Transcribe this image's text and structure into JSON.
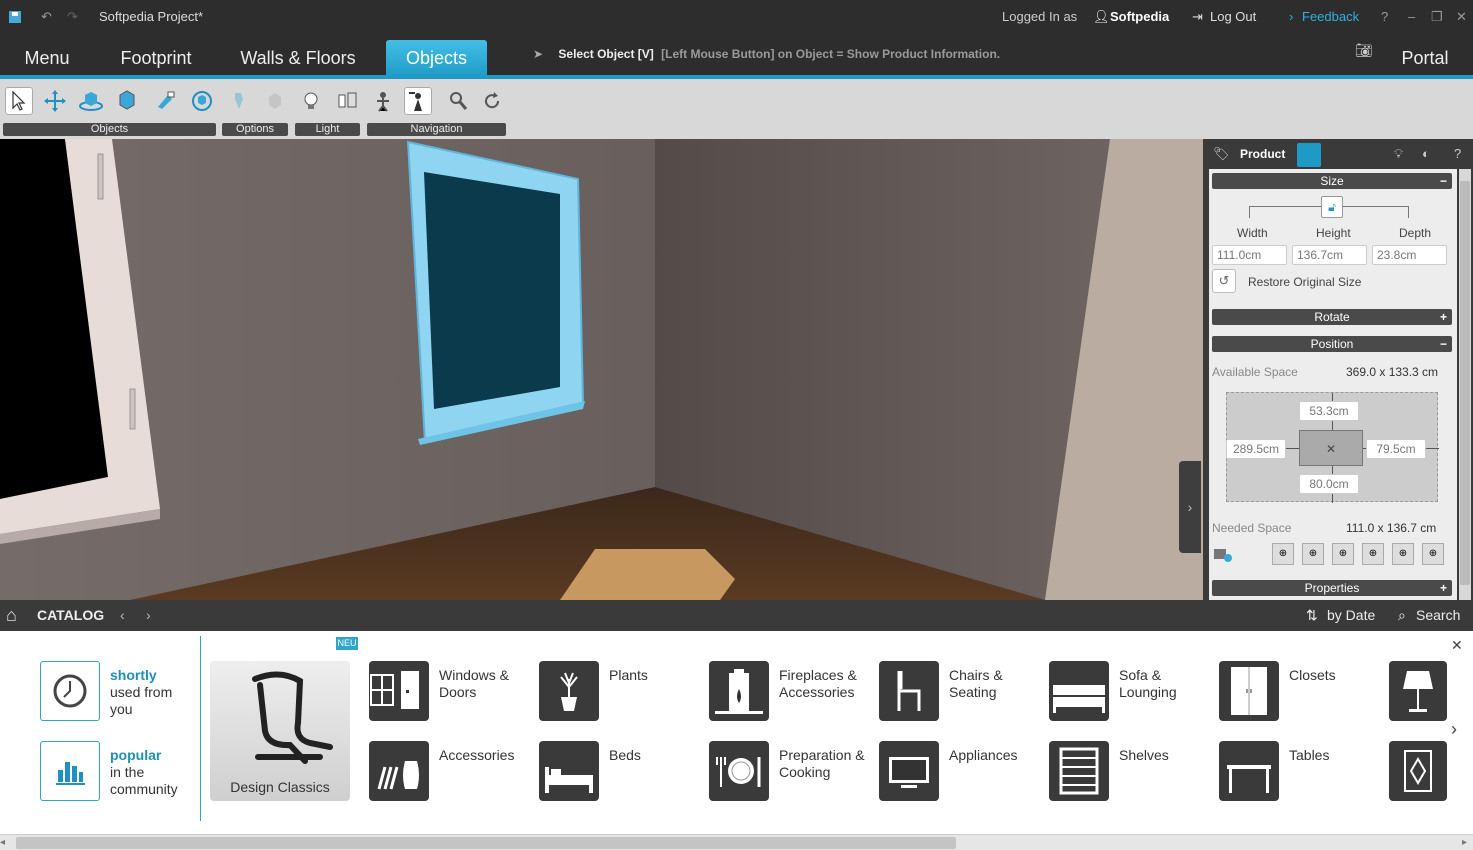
{
  "titlebar": {
    "project_title": "Softpedia Project*",
    "logged_in_as": "Logged In as",
    "username": "Softpedia",
    "logout": "Log Out",
    "feedback": "Feedback",
    "help": "?"
  },
  "nav": {
    "tabs": [
      {
        "label": "Menu"
      },
      {
        "label": "Footprint"
      },
      {
        "label": "Walls & Floors"
      },
      {
        "label": "Objects"
      }
    ],
    "active_tab": "Objects",
    "hint_bold": "Select Object [V]",
    "hint_text": "[Left Mouse Button] on Object = Show Product Information.",
    "portal": "Portal"
  },
  "toolbar": {
    "groups": [
      {
        "label": "Objects"
      },
      {
        "label": "Options"
      },
      {
        "label": "Light"
      },
      {
        "label": "Navigation"
      }
    ]
  },
  "panel": {
    "tab_product": "Product",
    "size_section": "Size",
    "width_label": "Width",
    "height_label": "Height",
    "depth_label": "Depth",
    "width_value": "111.0cm",
    "height_value": "136.7cm",
    "depth_value": "23.8cm",
    "restore": "Restore Original Size",
    "rotate_section": "Rotate",
    "position_section": "Position",
    "available_label": "Available Space",
    "available_value": "369.0 x 133.3 cm",
    "pos_top": "53.3cm",
    "pos_left": "289.5cm",
    "pos_right": "79.5cm",
    "pos_bottom": "80.0cm",
    "needed_label": "Needed Space",
    "needed_value": "111.0 x 136.7 cm",
    "properties_section": "Properties",
    "minus": "−",
    "plus": "+"
  },
  "catalog_bar": {
    "title": "CATALOG",
    "sort": "by Date",
    "search": "Search"
  },
  "catalog": {
    "shortly_hl": "shortly",
    "shortly_rest": "used from you",
    "popular_hl": "popular",
    "popular_rest": "in the community",
    "design_classics": "Design Classics",
    "new_badge": "NEU",
    "items": [
      {
        "label": "Windows & Doors"
      },
      {
        "label": "Accessories"
      },
      {
        "label": "Plants"
      },
      {
        "label": "Beds"
      },
      {
        "label": "Fireplaces & Accessories"
      },
      {
        "label": "Preparation & Cooking"
      },
      {
        "label": "Chairs & Seating"
      },
      {
        "label": "Appliances"
      },
      {
        "label": "Sofa & Lounging"
      },
      {
        "label": "Shelves"
      },
      {
        "label": "Closets"
      },
      {
        "label": "Tables"
      }
    ]
  },
  "colors": {
    "accent": "#1f9ac6",
    "dark_bg": "#2d2d2d",
    "window_frame": "#8fd4f0"
  }
}
